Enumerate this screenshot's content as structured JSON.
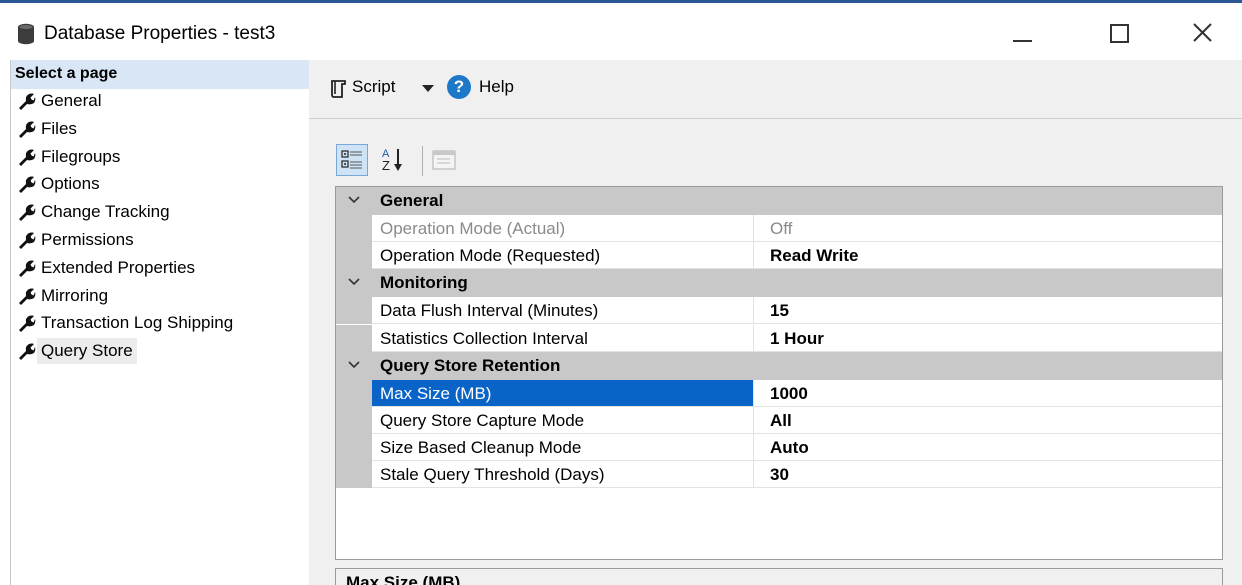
{
  "window": {
    "title": "Database Properties - test3"
  },
  "left_pane": {
    "header": "Select a page",
    "items": [
      {
        "label": "General"
      },
      {
        "label": "Files"
      },
      {
        "label": "Filegroups"
      },
      {
        "label": "Options"
      },
      {
        "label": "Change Tracking"
      },
      {
        "label": "Permissions"
      },
      {
        "label": "Extended Properties"
      },
      {
        "label": "Mirroring"
      },
      {
        "label": "Transaction Log Shipping"
      },
      {
        "label": "Query Store"
      }
    ],
    "selected": "Query Store"
  },
  "toolbar": {
    "script_label": "Script",
    "help_label": "Help"
  },
  "property_grid": {
    "categories": [
      {
        "label": "General",
        "properties": [
          {
            "name": "Operation Mode (Actual)",
            "value": "Off",
            "readonly": true
          },
          {
            "name": "Operation Mode (Requested)",
            "value": "Read Write"
          }
        ]
      },
      {
        "label": "Monitoring",
        "properties": [
          {
            "name": "Data Flush Interval (Minutes)",
            "value": "15"
          },
          {
            "name": "Statistics Collection Interval",
            "value": "1 Hour"
          }
        ]
      },
      {
        "label": "Query Store Retention",
        "properties": [
          {
            "name": "Max Size (MB)",
            "value": "1000",
            "selected": true
          },
          {
            "name": "Query Store Capture Mode",
            "value": "All"
          },
          {
            "name": "Size Based Cleanup Mode",
            "value": "Auto"
          },
          {
            "name": "Stale Query Threshold (Days)",
            "value": "30"
          }
        ]
      }
    ]
  },
  "description": {
    "title": "Max Size (MB)"
  },
  "colors": {
    "selection": "#0a64c8",
    "category_band": "#c8c8c8",
    "left_header": "#d8e6f6",
    "accent_line": "#2b5797"
  },
  "icons": {
    "window": "database-icon",
    "nav": "wrench-icon",
    "script": "script-icon",
    "help": "help-icon"
  }
}
